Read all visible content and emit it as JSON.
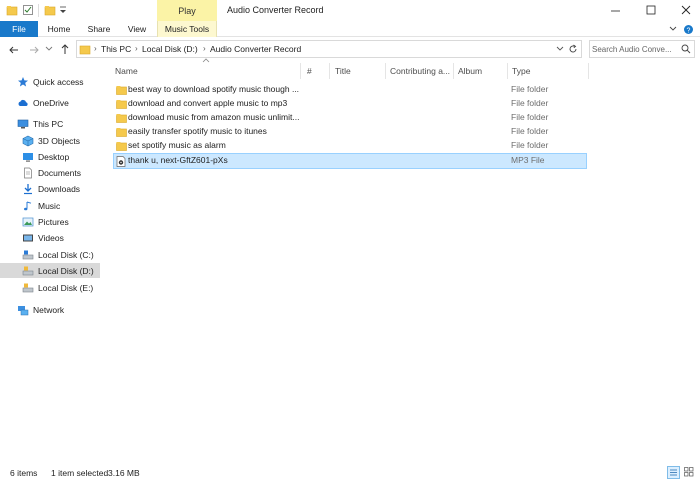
{
  "window": {
    "title": "Audio Converter Record",
    "context_tab": "Play"
  },
  "ribbon": {
    "tabs": [
      "File",
      "Home",
      "Share",
      "View",
      "Music Tools"
    ]
  },
  "address": {
    "crumbs": [
      "This PC",
      "Local Disk (D:)",
      "Audio Converter Record"
    ]
  },
  "search": {
    "placeholder": "Search Audio Conve..."
  },
  "sidebar": {
    "items": [
      {
        "label": "Quick access",
        "icon": "star-icon"
      },
      {
        "label": "OneDrive",
        "icon": "cloud-icon"
      },
      {
        "label": "This PC",
        "icon": "computer-icon"
      },
      {
        "label": "3D Objects",
        "icon": "cube-icon"
      },
      {
        "label": "Desktop",
        "icon": "desktop-icon"
      },
      {
        "label": "Documents",
        "icon": "document-icon"
      },
      {
        "label": "Downloads",
        "icon": "download-icon"
      },
      {
        "label": "Music",
        "icon": "music-note-icon"
      },
      {
        "label": "Pictures",
        "icon": "picture-icon"
      },
      {
        "label": "Videos",
        "icon": "video-icon"
      },
      {
        "label": "Local Disk (C:)",
        "icon": "drive-icon"
      },
      {
        "label": "Local Disk (D:)",
        "icon": "drive-icon"
      },
      {
        "label": "Local Disk (E:)",
        "icon": "drive-icon"
      },
      {
        "label": "Network",
        "icon": "network-icon"
      }
    ],
    "selected": "Local Disk (D:)"
  },
  "columns": [
    "Name",
    "#",
    "Title",
    "Contributing a...",
    "Album",
    "Type"
  ],
  "files": [
    {
      "name": "best way to download spotify music though ...",
      "type": "File folder",
      "icon": "folder-icon"
    },
    {
      "name": "download and convert apple music to mp3",
      "type": "File folder",
      "icon": "folder-icon"
    },
    {
      "name": "download music from amazon music unlimit...",
      "type": "File folder",
      "icon": "folder-icon"
    },
    {
      "name": "easily transfer spotify music to itunes",
      "type": "File folder",
      "icon": "folder-icon"
    },
    {
      "name": "set spotify music as alarm",
      "type": "File folder",
      "icon": "folder-icon"
    },
    {
      "name": "thank u, next-GftZ601-pXs",
      "type": "MP3 File",
      "icon": "audio-file-icon",
      "selected": true
    }
  ],
  "status": {
    "count": "6 items",
    "selection": "1 item selected",
    "size": "3.16 MB"
  },
  "colors": {
    "accent": "#1979ca",
    "context_tab": "#fbf3a6",
    "selection_bg": "#cce8ff",
    "selection_border": "#99d1ff",
    "folder": "#f5c94c"
  }
}
